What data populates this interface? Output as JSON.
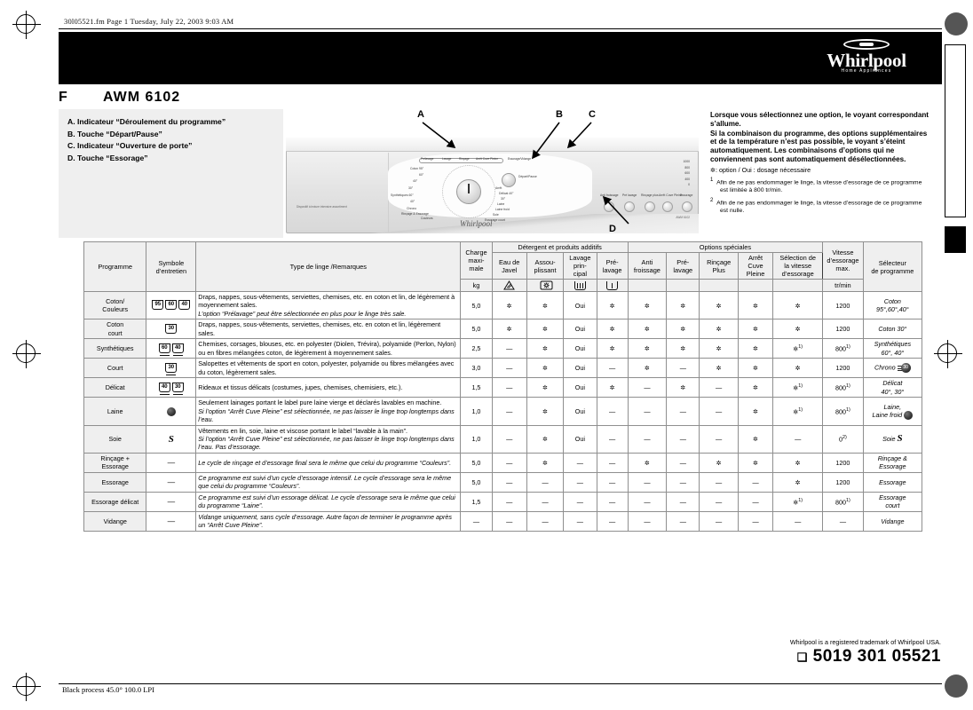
{
  "page": {
    "file_line": "30l05521.fm  Page 1  Tuesday, July 22, 2003  9:03 AM",
    "footer_process": "Black process 45.0° 100.0 LPI",
    "trademark": "Whirlpool is a registered trademark of Whirlpool USA.",
    "part_number": "5019 301 05521",
    "part_mark": "❑"
  },
  "brand": {
    "name": "Whirlpool",
    "tagline": "Home Appliances"
  },
  "model": {
    "language": "F",
    "code": "AWM  6102"
  },
  "legend": {
    "items": [
      "A. Indicateur “Déroulement du programme”",
      "B. Touche “Départ/Pause”",
      "C. Indicateur “Ouverture de porte”",
      "D. Touche “Essorage”"
    ]
  },
  "callouts": [
    "A",
    "B",
    "C",
    "D"
  ],
  "machine": {
    "lamp_labels": [
      "Prélavage",
      "Lavage",
      "Rinçage",
      "Arrêt Cuve Pleine",
      "Essorage/Vidange"
    ],
    "door_label": "Ouverture porte",
    "start_label": "Départ/Pause",
    "left_programs": [
      "Coton  95°",
      "60°",
      "40°",
      "30°",
      "Synthétiques  60°",
      "40°",
      "Chrono",
      "Rinçage & Essorage",
      "Couleurs"
    ],
    "right_programs": [
      "Arrêt",
      "Délicat  40°",
      "30°",
      "Laine",
      "Laine froid",
      "Soie",
      "Essorage court",
      "Vidange"
    ],
    "buttons": [
      "Anti froissage",
      "Pré lavage",
      "Rinçage plus",
      "Arrêt Cuve Pleine",
      "Essorage"
    ],
    "spin_values": [
      "1000",
      "800",
      "600",
      "400",
      "0"
    ],
    "note": "Dispositif à lecture intensive assortiment",
    "code": "AWM 6102"
  },
  "info": {
    "p1": "Lorsque vous sélectionnez une option, le voyant correspondant s’allume.",
    "p2": "Si la combinaison du programme, des options supplémentaires et de la température n’est pas possible, le voyant s’éteint automatiquement. Les combinaisons d’options qui ne conviennent pas sont automatiquement désélectionnées.",
    "option_line": ": option / Oui : dosage nécessaire",
    "footnote1": "Afin de ne pas endommager le linge, la vitesse d’essorage de ce programme est limitée à 800 tr/min.",
    "footnote2": "Afin de ne pas endommager le linge, la vitesse d’essorage de ce programme est nulle."
  },
  "table": {
    "headers": {
      "programme": "Programme",
      "symbole": "Symbole\nd’entretien",
      "type_linge": "Type de linge /Remarques",
      "charge": "Charge\nmaxi-\nmale",
      "charge_unit": "kg",
      "group_detergent": "Détergent et produits additifs",
      "group_options": "Options spéciales",
      "eau_javel": "Eau de\nJavel",
      "assouplissant": "Assou-\nplissant",
      "lavage_principal": "Lavage\nprin-\ncipal",
      "prelavage_col": "Pré-\nlavage",
      "anti_froissage": "Anti\nfroissage",
      "prelavage_opt": "Pré-\nlavage",
      "rincage_plus": "Rinçage\nPlus",
      "arret_cuve": "Arrêt\nCuve\nPleine",
      "selection_vitesse": "Sélection de\nla vitesse\nd’essorage",
      "vitesse_max": "Vitesse\nd’essorage\nmax.",
      "vitesse_unit": "tr/min",
      "selecteur": "Sélecteur\nde programme"
    },
    "rows": [
      {
        "programme": "Coton/\nCouleurs",
        "symbols": [
          {
            "type": "tub",
            "label": "95"
          },
          {
            "type": "tub",
            "label": "60"
          },
          {
            "type": "tub",
            "label": "40"
          }
        ],
        "description": "Draps, nappes, sous-vêtements, serviettes, chemises, etc. en coton et lin, de légèrement à moyennement sales.",
        "description_italic": "L’option “Prélavage” peut être sélectionnée en plus pour le linge très sale.",
        "charge": "5,0",
        "eau_javel": "*",
        "assouplissant": "*",
        "lavage_principal": "Oui",
        "prelavage_col": "*",
        "anti_froissage": "*",
        "prelavage_opt": "*",
        "rincage_plus": "*",
        "arret_cuve": "*",
        "selection_vitesse": "*",
        "selection_vitesse_fn": "",
        "vitesse": "1200",
        "vitesse_fn": "",
        "selecteur": "Coton\n95°,60°,40°"
      },
      {
        "programme": "Coton\ncourt",
        "symbols": [
          {
            "type": "tub",
            "label": "30"
          }
        ],
        "description": "Draps, nappes, sous-vêtements, serviettes, chemises, etc. en coton et lin, légèrement sales.",
        "description_italic": "",
        "charge": "5,0",
        "eau_javel": "*",
        "assouplissant": "*",
        "lavage_principal": "Oui",
        "prelavage_col": "*",
        "anti_froissage": "*",
        "prelavage_opt": "*",
        "rincage_plus": "*",
        "arret_cuve": "*",
        "selection_vitesse": "*",
        "selection_vitesse_fn": "",
        "vitesse": "1200",
        "vitesse_fn": "",
        "selecteur": "Coton 30°"
      },
      {
        "programme": "Synthétiques",
        "symbols": [
          {
            "type": "tub-under",
            "label": "60"
          },
          {
            "type": "tub-under",
            "label": "40"
          }
        ],
        "description": "Chemises, corsages, blouses, etc. en polyester (Diolen, Trévira), polyamide (Perlon, Nylon) ou en fibres mélangées coton, de légèrement à moyennement sales.",
        "description_italic": "",
        "charge": "2,5",
        "eau_javel": "—",
        "assouplissant": "*",
        "lavage_principal": "Oui",
        "prelavage_col": "*",
        "anti_froissage": "*",
        "prelavage_opt": "*",
        "rincage_plus": "*",
        "arret_cuve": "*",
        "selection_vitesse": "*",
        "selection_vitesse_fn": "1)",
        "vitesse": "800",
        "vitesse_fn": "1)",
        "selecteur": "Synthétiques\n60°, 40°"
      },
      {
        "programme": "Court",
        "symbols": [
          {
            "type": "tub-under",
            "label": "30"
          }
        ],
        "description": "Salopettes et vêtements de sport en coton, polyester, polyamide ou fibres mélangées avec du coton, légèrement sales.",
        "description_italic": "",
        "charge": "3,0",
        "eau_javel": "—",
        "assouplissant": "*",
        "lavage_principal": "Oui",
        "prelavage_col": "—",
        "anti_froissage": "*",
        "prelavage_opt": "—",
        "rincage_plus": "*",
        "arret_cuve": "*",
        "selection_vitesse": "*",
        "selection_vitesse_fn": "",
        "vitesse": "1200",
        "vitesse_fn": "",
        "selecteur": "Chrono"
      },
      {
        "programme": "Délicat",
        "symbols": [
          {
            "type": "tub-under2",
            "label": "40"
          },
          {
            "type": "tub-under2",
            "label": "30"
          }
        ],
        "description": "Rideaux et tissus délicats (costumes, jupes, chemises, chemisiers, etc.).",
        "description_italic": "",
        "charge": "1,5",
        "eau_javel": "—",
        "assouplissant": "*",
        "lavage_principal": "Oui",
        "prelavage_col": "*",
        "anti_froissage": "—",
        "prelavage_opt": "*",
        "rincage_plus": "—",
        "arret_cuve": "*",
        "selection_vitesse": "*",
        "selection_vitesse_fn": "1)",
        "vitesse": "800",
        "vitesse_fn": "1)",
        "selecteur": "Délicat\n40°, 30°"
      },
      {
        "programme": "Laine",
        "symbols": [
          {
            "type": "wool",
            "label": ""
          }
        ],
        "description": "Seulement lainages portant le label pure laine vierge et déclarés lavables en machine.",
        "description_italic": "Si l’option “Arrêt Cuve Pleine” est sélectionnée, ne pas laisser le linge trop longtemps dans l’eau.",
        "charge": "1,0",
        "eau_javel": "—",
        "assouplissant": "*",
        "lavage_principal": "Oui",
        "prelavage_col": "—",
        "anti_froissage": "—",
        "prelavage_opt": "—",
        "rincage_plus": "—",
        "arret_cuve": "*",
        "selection_vitesse": "*",
        "selection_vitesse_fn": "1)",
        "vitesse": "800",
        "vitesse_fn": "1)",
        "selecteur": "Laine,\nLaine froid"
      },
      {
        "programme": "Soie",
        "symbols": [
          {
            "type": "silk",
            "label": ""
          }
        ],
        "description": "Vêtements en lin, soie, laine et viscose portant le label “lavable à la main”.",
        "description_italic": "Si l’option “Arrêt Cuve Pleine” est sélectionnée, ne pas laisser le linge trop longtemps dans l’eau. Pas d’essorage.",
        "charge": "1,0",
        "eau_javel": "—",
        "assouplissant": "*",
        "lavage_principal": "Oui",
        "prelavage_col": "—",
        "anti_froissage": "—",
        "prelavage_opt": "—",
        "rincage_plus": "—",
        "arret_cuve": "*",
        "selection_vitesse": "—",
        "selection_vitesse_fn": "",
        "vitesse": "0",
        "vitesse_fn": "2)",
        "selecteur": "Soie"
      },
      {
        "programme": "Rinçage +\nEssorage",
        "symbols": [
          {
            "type": "dash",
            "label": "—"
          }
        ],
        "description": "",
        "description_italic": "Le cycle de rinçage et d’essorage final sera le même que celui du programme “Couleurs”.",
        "charge": "5,0",
        "eau_javel": "—",
        "assouplissant": "*",
        "lavage_principal": "—",
        "prelavage_col": "—",
        "anti_froissage": "*",
        "prelavage_opt": "—",
        "rincage_plus": "*",
        "arret_cuve": "*",
        "selection_vitesse": "*",
        "selection_vitesse_fn": "",
        "vitesse": "1200",
        "vitesse_fn": "",
        "selecteur": "Rinçage &\nEssorage"
      },
      {
        "programme": "Essorage",
        "symbols": [
          {
            "type": "dash",
            "label": "—"
          }
        ],
        "description": "",
        "description_italic": "Ce programme est suivi d’un cycle d’essorage intensif. Le cycle d’essorage sera le même que celui du programme “Couleurs”.",
        "charge": "5,0",
        "eau_javel": "—",
        "assouplissant": "—",
        "lavage_principal": "—",
        "prelavage_col": "—",
        "anti_froissage": "—",
        "prelavage_opt": "—",
        "rincage_plus": "—",
        "arret_cuve": "—",
        "selection_vitesse": "*",
        "selection_vitesse_fn": "",
        "vitesse": "1200",
        "vitesse_fn": "",
        "selecteur": "Essorage"
      },
      {
        "programme": "Essorage délicat",
        "symbols": [
          {
            "type": "dash",
            "label": "—"
          }
        ],
        "description": "",
        "description_italic": "Ce programme est suivi d’un essorage délicat. Le cycle d’essorage sera le même que celui du programme “Laine”.",
        "charge": "1,5",
        "eau_javel": "—",
        "assouplissant": "—",
        "lavage_principal": "—",
        "prelavage_col": "—",
        "anti_froissage": "—",
        "prelavage_opt": "—",
        "rincage_plus": "—",
        "arret_cuve": "—",
        "selection_vitesse": "*",
        "selection_vitesse_fn": "1)",
        "vitesse": "800",
        "vitesse_fn": "1)",
        "selecteur": "Essorage\ncourt"
      },
      {
        "programme": "Vidange",
        "symbols": [
          {
            "type": "dash",
            "label": "—"
          }
        ],
        "description": "",
        "description_italic": "Vidange uniquement, sans cycle d’essorage. Autre façon de terminer le programme après un “Arrêt Cuve Pleine”.",
        "charge": "—",
        "eau_javel": "—",
        "assouplissant": "—",
        "lavage_principal": "—",
        "prelavage_col": "—",
        "anti_froissage": "—",
        "prelavage_opt": "—",
        "rincage_plus": "—",
        "arret_cuve": "—",
        "selection_vitesse": "—",
        "selection_vitesse_fn": "",
        "vitesse": "—",
        "vitesse_fn": "",
        "selecteur": "Vidange"
      }
    ]
  }
}
